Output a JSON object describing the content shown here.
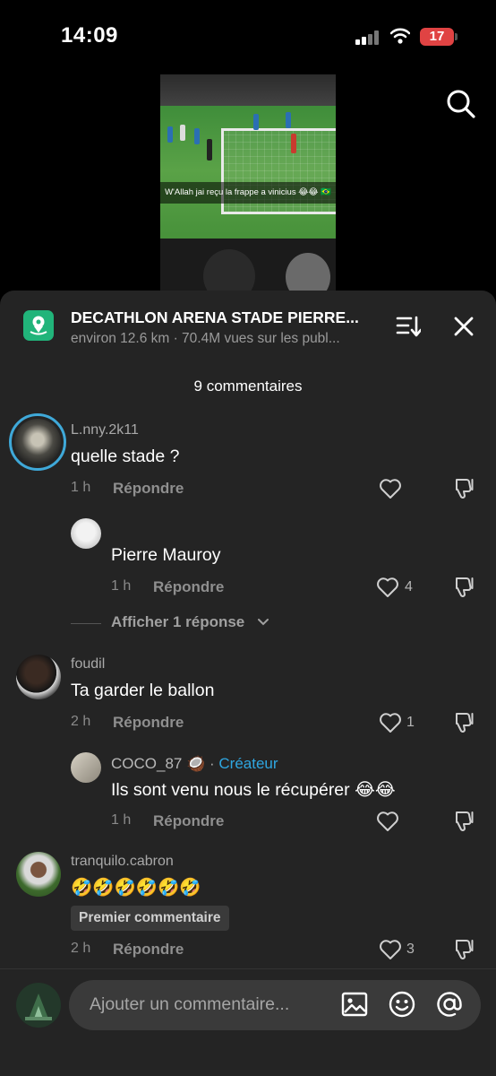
{
  "status_bar": {
    "time": "14:09",
    "battery": "17"
  },
  "video": {
    "caption": "W'Allah jai reçu la frappe a vinicius 😂😂 🇧🇷"
  },
  "location": {
    "title": "DECATHLON ARENA STADE PIERRE...",
    "subtitle": "environ 12.6 km · 70.4M vues sur les publ..."
  },
  "comments_count": "9 commentaires",
  "comments": [
    {
      "username": "L.nny.2k11",
      "text": "quelle stade ?",
      "time": "1 h",
      "reply_label": "Répondre",
      "likes": ""
    },
    {
      "username": "foudil",
      "text": "Ta garder le ballon",
      "time": "2 h",
      "reply_label": "Répondre",
      "likes": "1"
    },
    {
      "username": "tranquilo.cabron",
      "text": "🤣🤣🤣🤣🤣🤣",
      "badge": "Premier commentaire",
      "time": "2 h",
      "reply_label": "Répondre",
      "likes": "3"
    }
  ],
  "replies": [
    {
      "username": "",
      "text": "Pierre Mauroy",
      "time": "1 h",
      "reply_label": "Répondre",
      "likes": "4"
    },
    {
      "username": "COCO_87 🥥",
      "separator": "·",
      "tag": "Créateur",
      "text": "Ils sont venu nous le récupérer 😂😂",
      "time": "1 h",
      "reply_label": "Répondre",
      "likes": ""
    }
  ],
  "show_replies": "Afficher 1 réponse",
  "composer": {
    "placeholder": "Ajouter un commentaire..."
  },
  "colors": {
    "sheet": "#242424",
    "accent_green": "#21b47a",
    "creator_blue": "#2fa6e0",
    "battery_red": "#e04343"
  }
}
